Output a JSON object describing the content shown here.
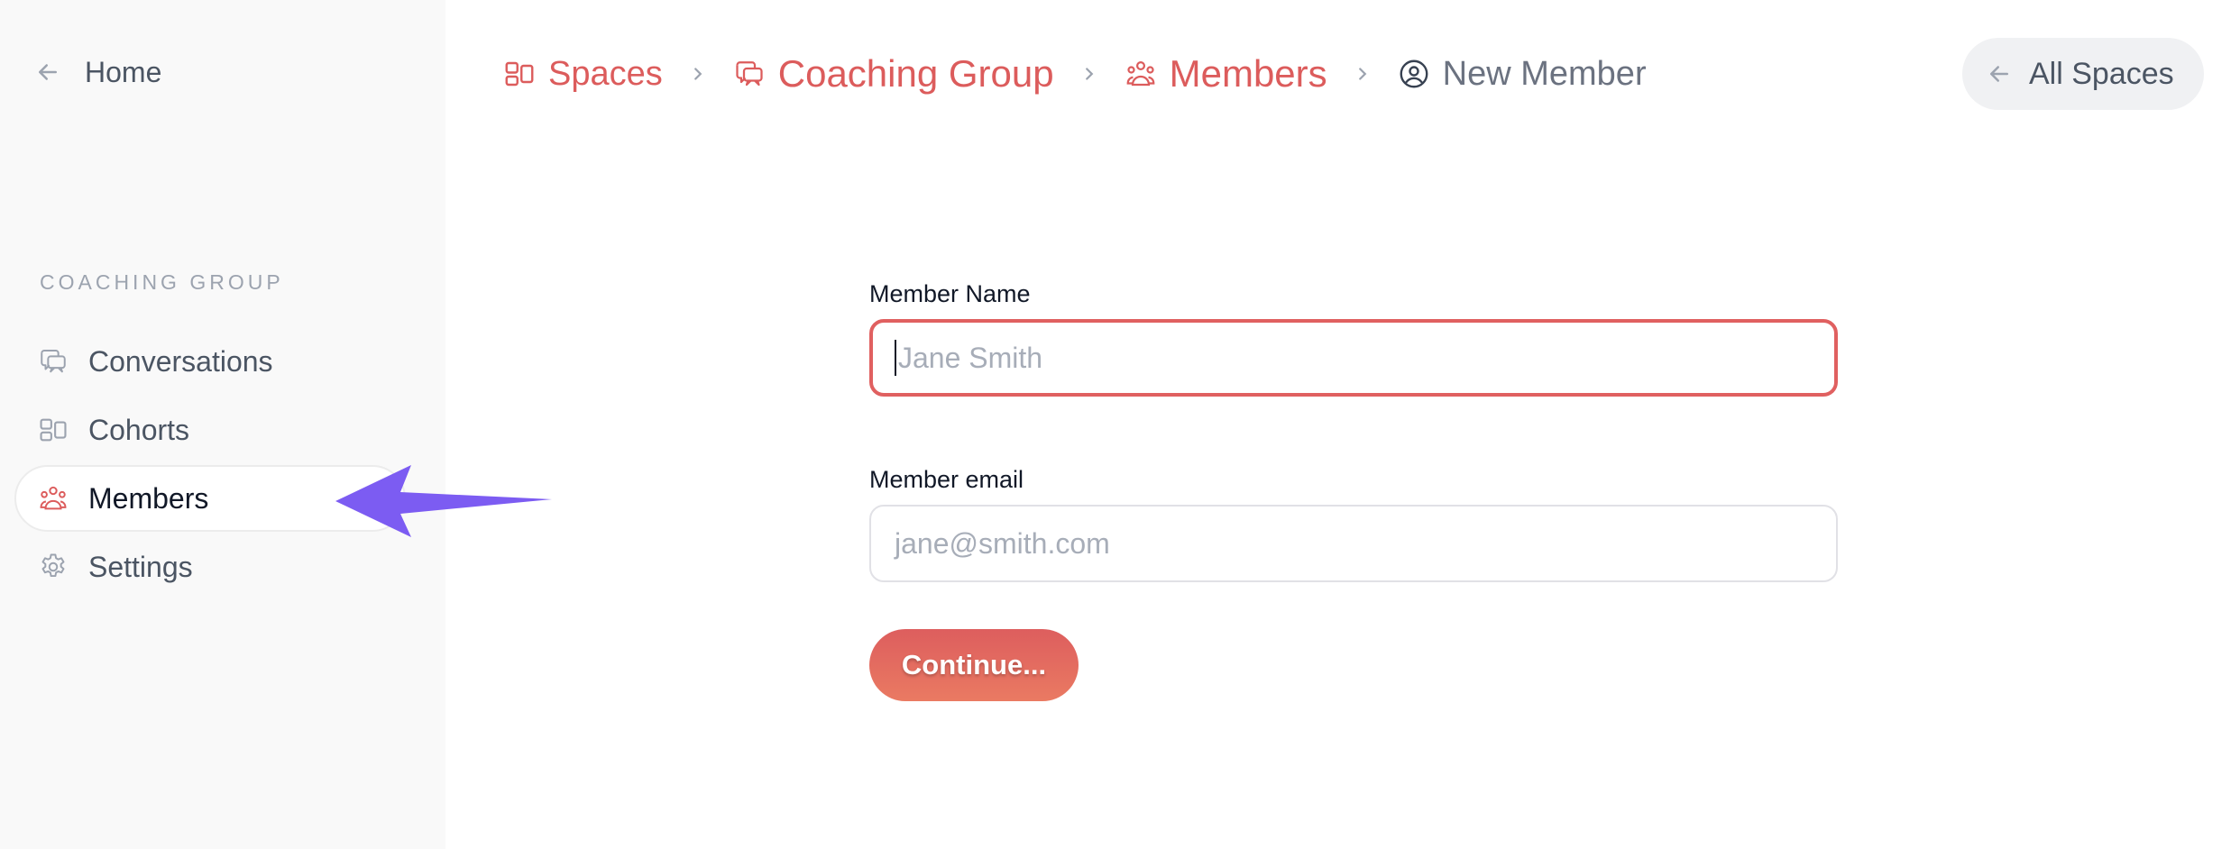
{
  "sidebar": {
    "home_label": "Home",
    "section_label": "COACHING GROUP",
    "items": [
      {
        "label": "Conversations",
        "icon": "chat-bubbles-icon",
        "active": false
      },
      {
        "label": "Cohorts",
        "icon": "layout-blocks-icon",
        "active": false
      },
      {
        "label": "Members",
        "icon": "users-group-icon",
        "active": true
      },
      {
        "label": "Settings",
        "icon": "gear-icon",
        "active": false
      }
    ]
  },
  "breadcrumb": {
    "items": [
      {
        "label": "Spaces",
        "icon": "layout-blocks-icon"
      },
      {
        "label": "Coaching Group",
        "icon": "chat-bubbles-icon"
      },
      {
        "label": "Members",
        "icon": "users-group-icon"
      },
      {
        "label": "New Member",
        "icon": "user-circle-icon"
      }
    ]
  },
  "header": {
    "all_spaces_label": "All Spaces"
  },
  "form": {
    "name_label": "Member Name",
    "name_value": "",
    "name_placeholder": "Jane Smith",
    "email_label": "Member email",
    "email_value": "",
    "email_placeholder": "jane@smith.com",
    "submit_label": "Continue..."
  },
  "annotation": {
    "arrow_color": "#7c5cf2",
    "points_to": "Members"
  },
  "colors": {
    "accent": "#dc5c5c",
    "sidebar_bg": "#f9f9f9",
    "focus_border": "#e06060"
  }
}
